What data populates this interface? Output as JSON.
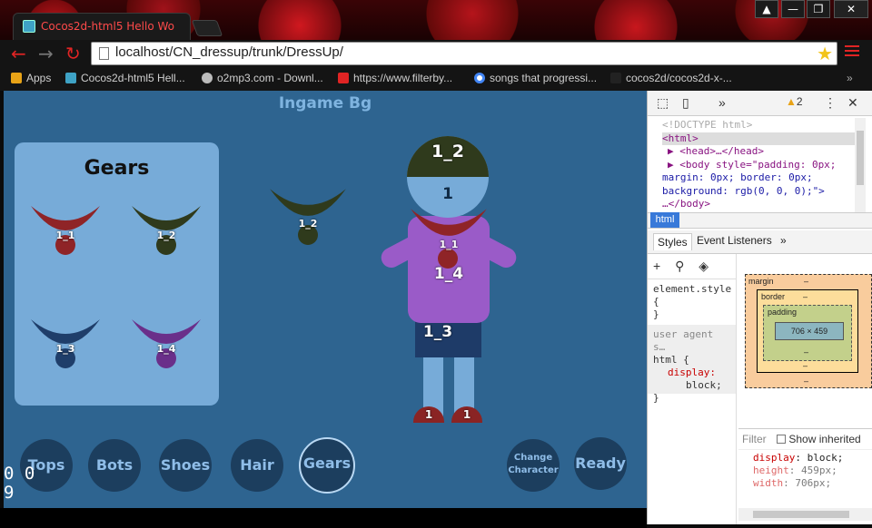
{
  "browser": {
    "tab_title": "Cocos2d-html5 Hello Wo",
    "url": "localhost/CN_dressup/trunk/DressUp/",
    "window_buttons": [
      "▲",
      "—",
      "❐",
      "✕"
    ]
  },
  "bookmarks": [
    {
      "label": "Apps",
      "icon": "apps-icon",
      "color": "#e8a317"
    },
    {
      "label": "Cocos2d-html5 Hell...",
      "icon": "cocos-icon",
      "color": "#3ea2c5"
    },
    {
      "label": "o2mp3.com - Downl...",
      "icon": "headphones-icon",
      "color": "#bbbbbb"
    },
    {
      "label": "https://www.filterby...",
      "icon": "fb-icon",
      "color": "#e02424"
    },
    {
      "label": "songs that progressi...",
      "icon": "google-icon",
      "color": "#4285f4"
    },
    {
      "label": "cocos2d/cocos2d-x-...",
      "icon": "github-icon",
      "color": "#222222"
    }
  ],
  "game": {
    "title": "Ingame Bg",
    "panel_title": "Gears",
    "gears": [
      {
        "label": "1_1",
        "color": "#8f2427"
      },
      {
        "label": "1_2",
        "color": "#2f3a1c"
      },
      {
        "label": "1_3",
        "color": "#1f3e6a"
      },
      {
        "label": "1_4",
        "color": "#6a2f8a"
      }
    ],
    "floating_gear_label": "1_2",
    "character": {
      "hair": "1_2",
      "head": "1",
      "necklace": "1_1",
      "top": "1_4",
      "bottom": "1_3",
      "shoe_left": "1",
      "shoe_right": "1"
    },
    "buttons": {
      "tops": "Tops",
      "bots": "Bots",
      "shoes": "Shoes",
      "hair": "Hair",
      "gears": "Gears",
      "change_character": "Change Character",
      "ready": "Ready"
    },
    "fps_line1": "0 0",
    "fps_line2": "9"
  },
  "devtools": {
    "warnings": "2",
    "dom_lines": [
      "<!DOCTYPE html>",
      "<html>",
      "▶ <head>…</head>",
      "▶ <body style=\"padding: 0px;",
      "margin: 0px; border: 0px;",
      "background: rgb(0, 0, 0);\">",
      "…</body>"
    ],
    "breadcrumb": "html",
    "tabs": {
      "styles": "Styles",
      "event_listeners": "Event Listeners"
    },
    "element_style": [
      "element.style",
      "{",
      "}"
    ],
    "user_agent": [
      "user agent s…",
      "html {",
      "display:",
      "block;",
      "}"
    ],
    "box_model": {
      "margin": "margin",
      "border": "border",
      "padding": "padding",
      "dash": "–",
      "content": "706 × 459"
    },
    "filter": "Filter",
    "show_inherited": "Show inherited",
    "computed": [
      {
        "prop": "display",
        "value": "block;"
      },
      {
        "prop": "height",
        "value": "459px;"
      },
      {
        "prop": "width",
        "value": "706px;"
      }
    ]
  }
}
